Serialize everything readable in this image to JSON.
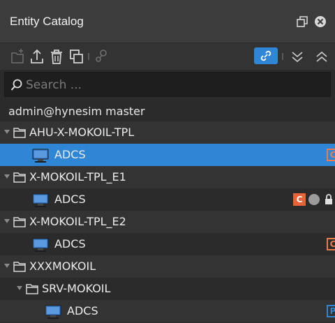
{
  "panel": {
    "title": "Entity Catalog"
  },
  "toolbar": {
    "icons": [
      "new-folder-icon",
      "upload-icon",
      "delete-icon",
      "duplicate-icon",
      "link-settings-icon",
      "link-icon",
      "collapse-all-icon",
      "expand-all-icon"
    ]
  },
  "search": {
    "placeholder": "Search ..."
  },
  "server": {
    "label": "admin@hynesim master"
  },
  "tree": [
    {
      "type": "folder",
      "label": "AHU-X-MOKOIL-TPL",
      "depth": 0
    },
    {
      "type": "item",
      "label": "ADCS",
      "depth": 1,
      "selected": true,
      "badge": "C"
    },
    {
      "type": "folder",
      "label": "X-MOKOIL-TPL_E1",
      "depth": 0
    },
    {
      "type": "item",
      "label": "ADCS",
      "depth": 1,
      "badge": "C",
      "status": "offline",
      "locked": true
    },
    {
      "type": "folder",
      "label": "X-MOKOIL-TPL_E2",
      "depth": 0
    },
    {
      "type": "item",
      "label": "ADCS",
      "depth": 1,
      "badge": "C"
    },
    {
      "type": "folder",
      "label": "XXXMOKOIL",
      "depth": 0
    },
    {
      "type": "folder",
      "label": "SRV-MOKOIL",
      "depth": 1
    },
    {
      "type": "item",
      "label": "ADCS",
      "depth": 2,
      "badge": "P"
    }
  ],
  "colors": {
    "accent": "#2e86d4",
    "badge_orange": "#f07a4a",
    "background": "#2b2b2b"
  }
}
